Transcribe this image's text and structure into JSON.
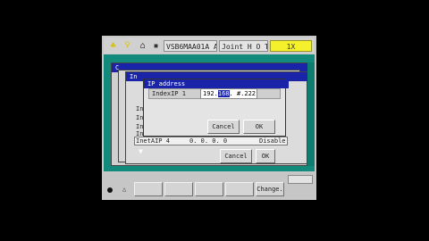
{
  "status": {
    "field1": "VSB6MAA01A A",
    "field2": "Joint H O T ⊗",
    "field3": "1X"
  },
  "background": {
    "title1": "C",
    "title2": "In",
    "stack_labels": [
      "In",
      "In",
      "In",
      "In"
    ],
    "right_labels": [
      "te",
      "e",
      "e"
    ]
  },
  "table_row": {
    "label": "InetAIP 4",
    "value": "0.  0.  0.  0",
    "state": "Disable"
  },
  "dialog": {
    "title": "IP address",
    "field_label": "IndexIP 1",
    "ip_prefix": "192.",
    "ip_selected": "168",
    "ip_suffix": ".  #.222",
    "cancel": "Cancel",
    "ok": "OK"
  },
  "outer_dialog": {
    "cancel": "Cancel",
    "ok": "OK"
  },
  "softkeys": {
    "left_mark": "△",
    "change": "Change."
  }
}
